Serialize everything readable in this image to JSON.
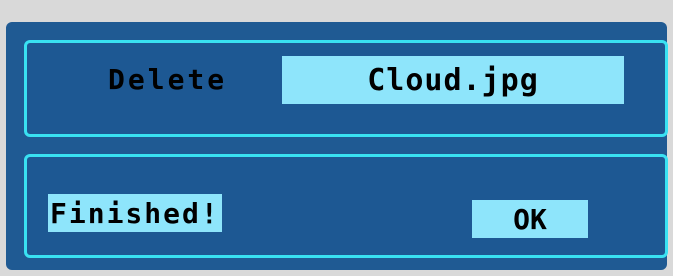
{
  "dialog": {
    "action_label": "Delete",
    "filename": "Cloud.jpg",
    "status": "Finished!",
    "ok_label": "OK"
  },
  "colors": {
    "background": "#d9d9d9",
    "dialog_bg": "#1f5a93",
    "panel_border": "#39e1f2",
    "field_bg": "#8ee5fb",
    "text": "#000000"
  }
}
